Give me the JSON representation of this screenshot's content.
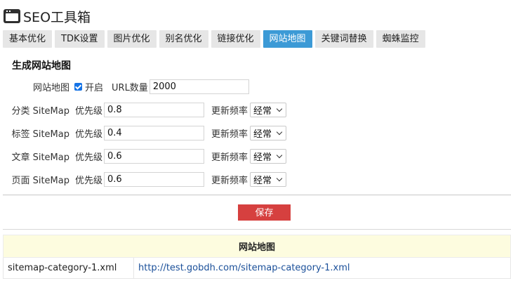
{
  "header": {
    "title": "SEO工具箱",
    "icon": "window-icon"
  },
  "tabs": [
    {
      "label": "基本优化",
      "active": false
    },
    {
      "label": "TDK设置",
      "active": false
    },
    {
      "label": "图片优化",
      "active": false
    },
    {
      "label": "别名优化",
      "active": false
    },
    {
      "label": "链接优化",
      "active": false
    },
    {
      "label": "网站地图",
      "active": true
    },
    {
      "label": "关键词替换",
      "active": false
    },
    {
      "label": "蜘蛛监控",
      "active": false
    }
  ],
  "section": {
    "title": "生成网站地图"
  },
  "sitemap": {
    "label": "网站地图",
    "enable_label": "开启",
    "enabled": true,
    "url_count_label": "URL数量",
    "url_count": "2000"
  },
  "rows": [
    {
      "label": "分类 SiteMap",
      "priority_label": "优先级",
      "priority": "0.8",
      "freq_label": "更新频率",
      "freq": "经常"
    },
    {
      "label": "标签 SiteMap",
      "priority_label": "优先级",
      "priority": "0.4",
      "freq_label": "更新频率",
      "freq": "经常"
    },
    {
      "label": "文章 SiteMap",
      "priority_label": "优先级",
      "priority": "0.6",
      "freq_label": "更新频率",
      "freq": "经常"
    },
    {
      "label": "页面 SiteMap",
      "priority_label": "优先级",
      "priority": "0.6",
      "freq_label": "更新频率",
      "freq": "经常"
    }
  ],
  "save_label": "保存",
  "table": {
    "header": "网站地图",
    "rows": [
      {
        "file": "sitemap-category-1.xml",
        "url": "http://test.gobdh.com/sitemap-category-1.xml"
      }
    ]
  },
  "colors": {
    "accent": "#3c9ad6",
    "save": "#d6403f",
    "table_header_bg": "#fdfcdf"
  }
}
